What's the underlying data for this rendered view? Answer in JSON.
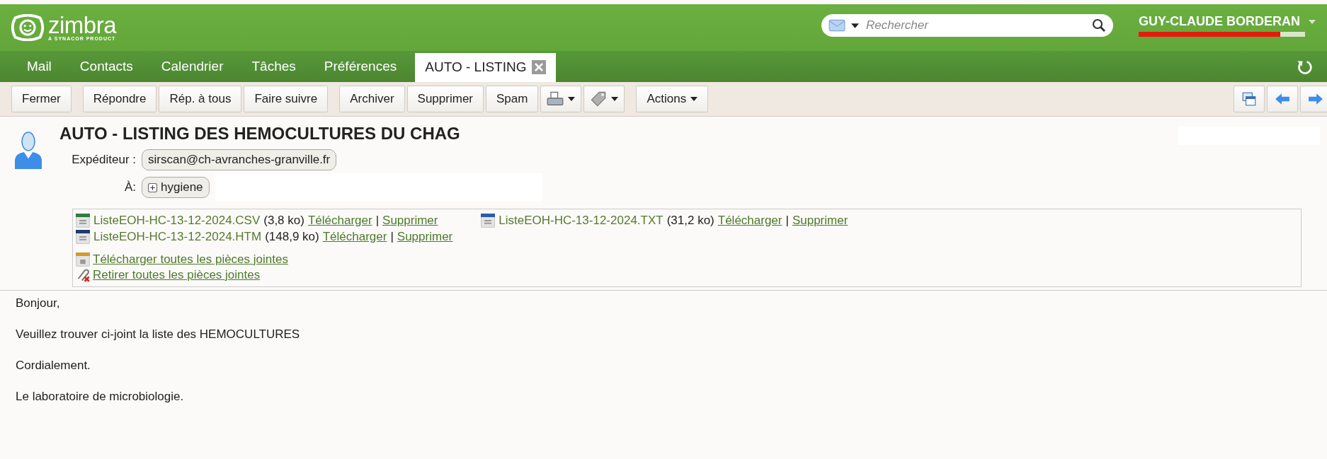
{
  "logo": {
    "name": "zimbra",
    "tagline": "A SYNACOR PRODUCT"
  },
  "search": {
    "placeholder": "Rechercher"
  },
  "user": {
    "name": "GUY-CLAUDE BORDERAN",
    "quota": {
      "level": 0.85
    }
  },
  "tabs": [
    {
      "label": "Mail",
      "selected": false,
      "closable": false
    },
    {
      "label": "Contacts",
      "selected": false,
      "closable": false
    },
    {
      "label": "Calendrier",
      "selected": false,
      "closable": false
    },
    {
      "label": "Tâches",
      "selected": false,
      "closable": false
    },
    {
      "label": "Préférences",
      "selected": false,
      "closable": false
    },
    {
      "label": "AUTO - LISTING",
      "selected": true,
      "closable": true
    }
  ],
  "toolbar": [
    {
      "kind": "text",
      "label": "Fermer"
    },
    {
      "kind": "gap"
    },
    {
      "kind": "text",
      "label": "Répondre"
    },
    {
      "kind": "text",
      "label": "Rép. à tous"
    },
    {
      "kind": "text",
      "label": "Faire suivre"
    },
    {
      "kind": "gap"
    },
    {
      "kind": "text",
      "label": "Archiver"
    },
    {
      "kind": "text",
      "label": "Supprimer"
    },
    {
      "kind": "text",
      "label": "Spam"
    },
    {
      "kind": "print"
    },
    {
      "kind": "tag"
    },
    {
      "kind": "gap"
    },
    {
      "kind": "menu",
      "label": "Actions"
    }
  ],
  "message": {
    "subject": "AUTO - LISTING DES HEMOCULTURES DU CHAG",
    "from_label": "Expéditeur :",
    "from": "sirscan@ch-avranches-granville.fr",
    "to_label": "À:",
    "to": "hygiene",
    "attachments": [
      {
        "kind": "csv",
        "name": "ListeEOH-HC-13-12-2024.CSV",
        "size": "(3,8 ko)",
        "download": "Télécharger",
        "separator": "|",
        "remove": "Supprimer"
      },
      {
        "kind": "txt",
        "name": "ListeEOH-HC-13-12-2024.TXT",
        "size": "(31,2 ko)",
        "download": "Télécharger",
        "separator": "|",
        "remove": "Supprimer"
      },
      {
        "kind": "htm",
        "name": "ListeEOH-HC-13-12-2024.HTM",
        "size": "(148,9 ko)",
        "download": "Télécharger",
        "separator": "|",
        "remove": "Supprimer"
      }
    ],
    "download_all": "Télécharger toutes les pièces jointes",
    "remove_all": "Retirer toutes les pièces jointes",
    "body": [
      "Bonjour,",
      "Veuillez trouver ci-joint la liste des HEMOCULTURES",
      "Cordialement.",
      "Le laboratoire de microbiologie."
    ]
  }
}
